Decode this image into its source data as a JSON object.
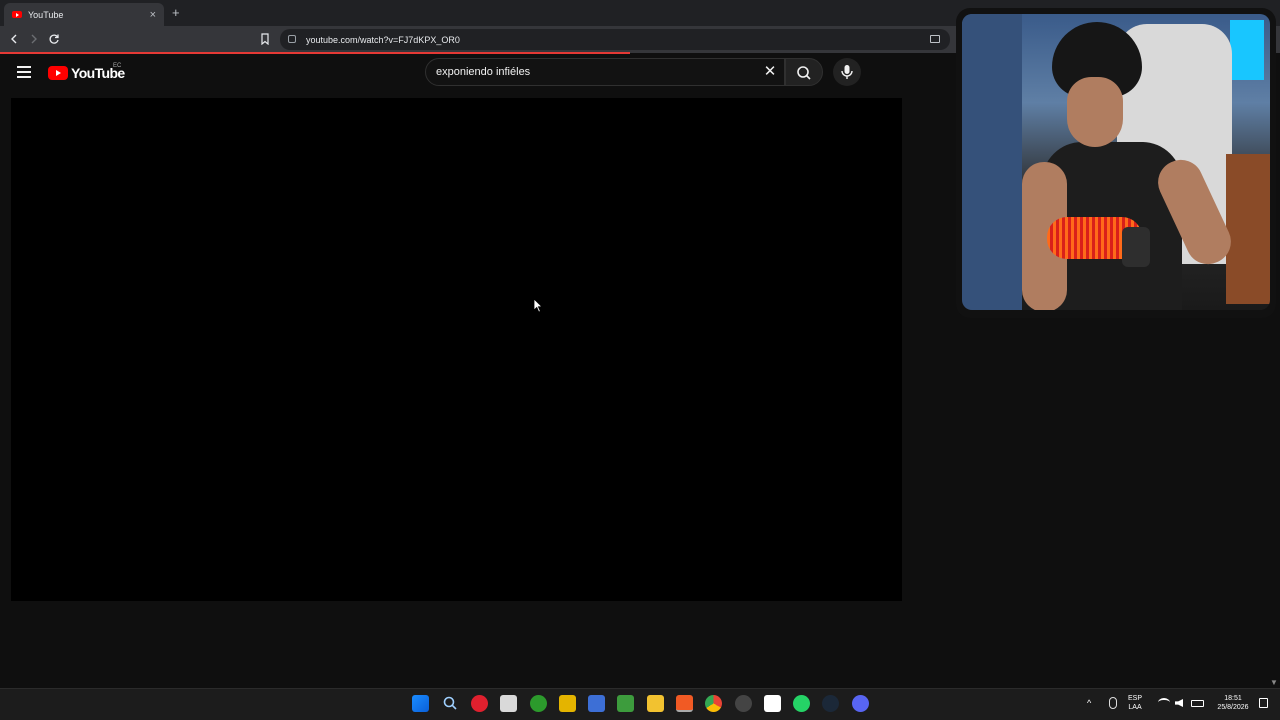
{
  "browser": {
    "tab_title": "YouTube",
    "tab_close": "×",
    "new_tab": "+",
    "url": "youtube.com/watch?v=FJ7dKPX_OR0"
  },
  "youtube": {
    "logo_text": "YouTube",
    "country_code": "EC",
    "search_query": "exponiendo infiéles",
    "clear_symbol": "✕"
  },
  "colors": {
    "brand_red": "#ff0000",
    "page_bg": "#0f0f0f",
    "player_bg": "#000000"
  },
  "icons": {
    "back": "back-icon",
    "forward": "forward-icon",
    "reload": "reload-icon",
    "bookmark": "bookmark-icon",
    "search": "search-icon",
    "mic": "microphone-icon"
  },
  "taskbar": {
    "language": "ESP",
    "layout": "LAA",
    "time": "18:51",
    "date": "25/8/2026"
  }
}
